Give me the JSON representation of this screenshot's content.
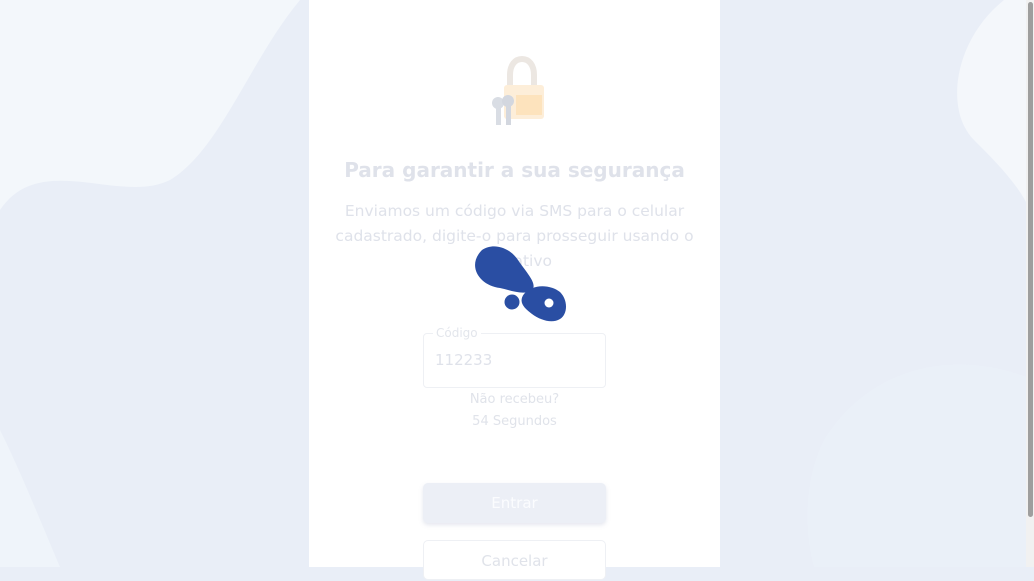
{
  "security": {
    "title": "Para garantir a sua segurança",
    "subtitle": "Enviamos um código via SMS para o celular cadastrado, digite-o para prosseguir usando o aplicativo"
  },
  "code_input": {
    "label": "Código",
    "value": "112233"
  },
  "resend": {
    "question": "Não recebeu?",
    "timer": "54 Segundos"
  },
  "buttons": {
    "enter_label": "Entrar",
    "cancel_label": "Cancelar"
  },
  "icons": {
    "lock": "lock-with-keys-icon",
    "loading": "loading-footprint-icon"
  },
  "colors": {
    "brand_blue": "#2a4ea3",
    "background": "#e9eef7"
  }
}
